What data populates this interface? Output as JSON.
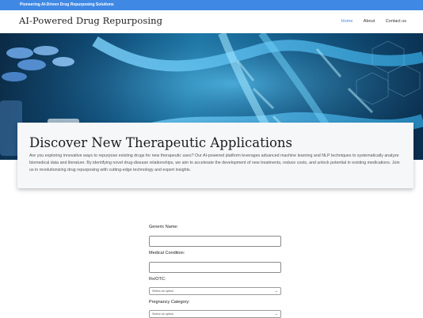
{
  "top_bar": {
    "text": "Pioneering AI-Driven Drug Repurposing Solutions"
  },
  "navbar": {
    "brand": "AI-Powered Drug Repurposing",
    "links": [
      {
        "label": "Home",
        "active": true
      },
      {
        "label": "About",
        "active": false
      },
      {
        "label": "Contact us",
        "active": false
      }
    ]
  },
  "hero": {
    "title": "Discover New Therapeutic Applications",
    "description": "Are you exploring innovative ways to repurpose existing drugs for new therapeutic uses? Our AI-powered platform leverages advanced machine learning and NLP techniques to systematically analyze biomedical data and literature. By identifying novel drug-disease relationships, we aim to accelerate the development of new treatments, reduce costs, and unlock potential in existing medications. Join us in revolutionizing drug repurposing with cutting-edge technology and expert insights."
  },
  "form": {
    "generic_name": {
      "label": "Generic Name:",
      "value": ""
    },
    "medical_condition": {
      "label": "Medical Condition:",
      "value": ""
    },
    "rx_otc": {
      "label": "Rx/OTC:",
      "selected": "Select an option"
    },
    "pregnancy_category": {
      "label": "Pregnancy Category:",
      "selected": "Select an option"
    }
  },
  "colors": {
    "accent": "#3f88e4",
    "hero_dark": "#0b2a45",
    "hero_light": "#5fc3ee"
  }
}
